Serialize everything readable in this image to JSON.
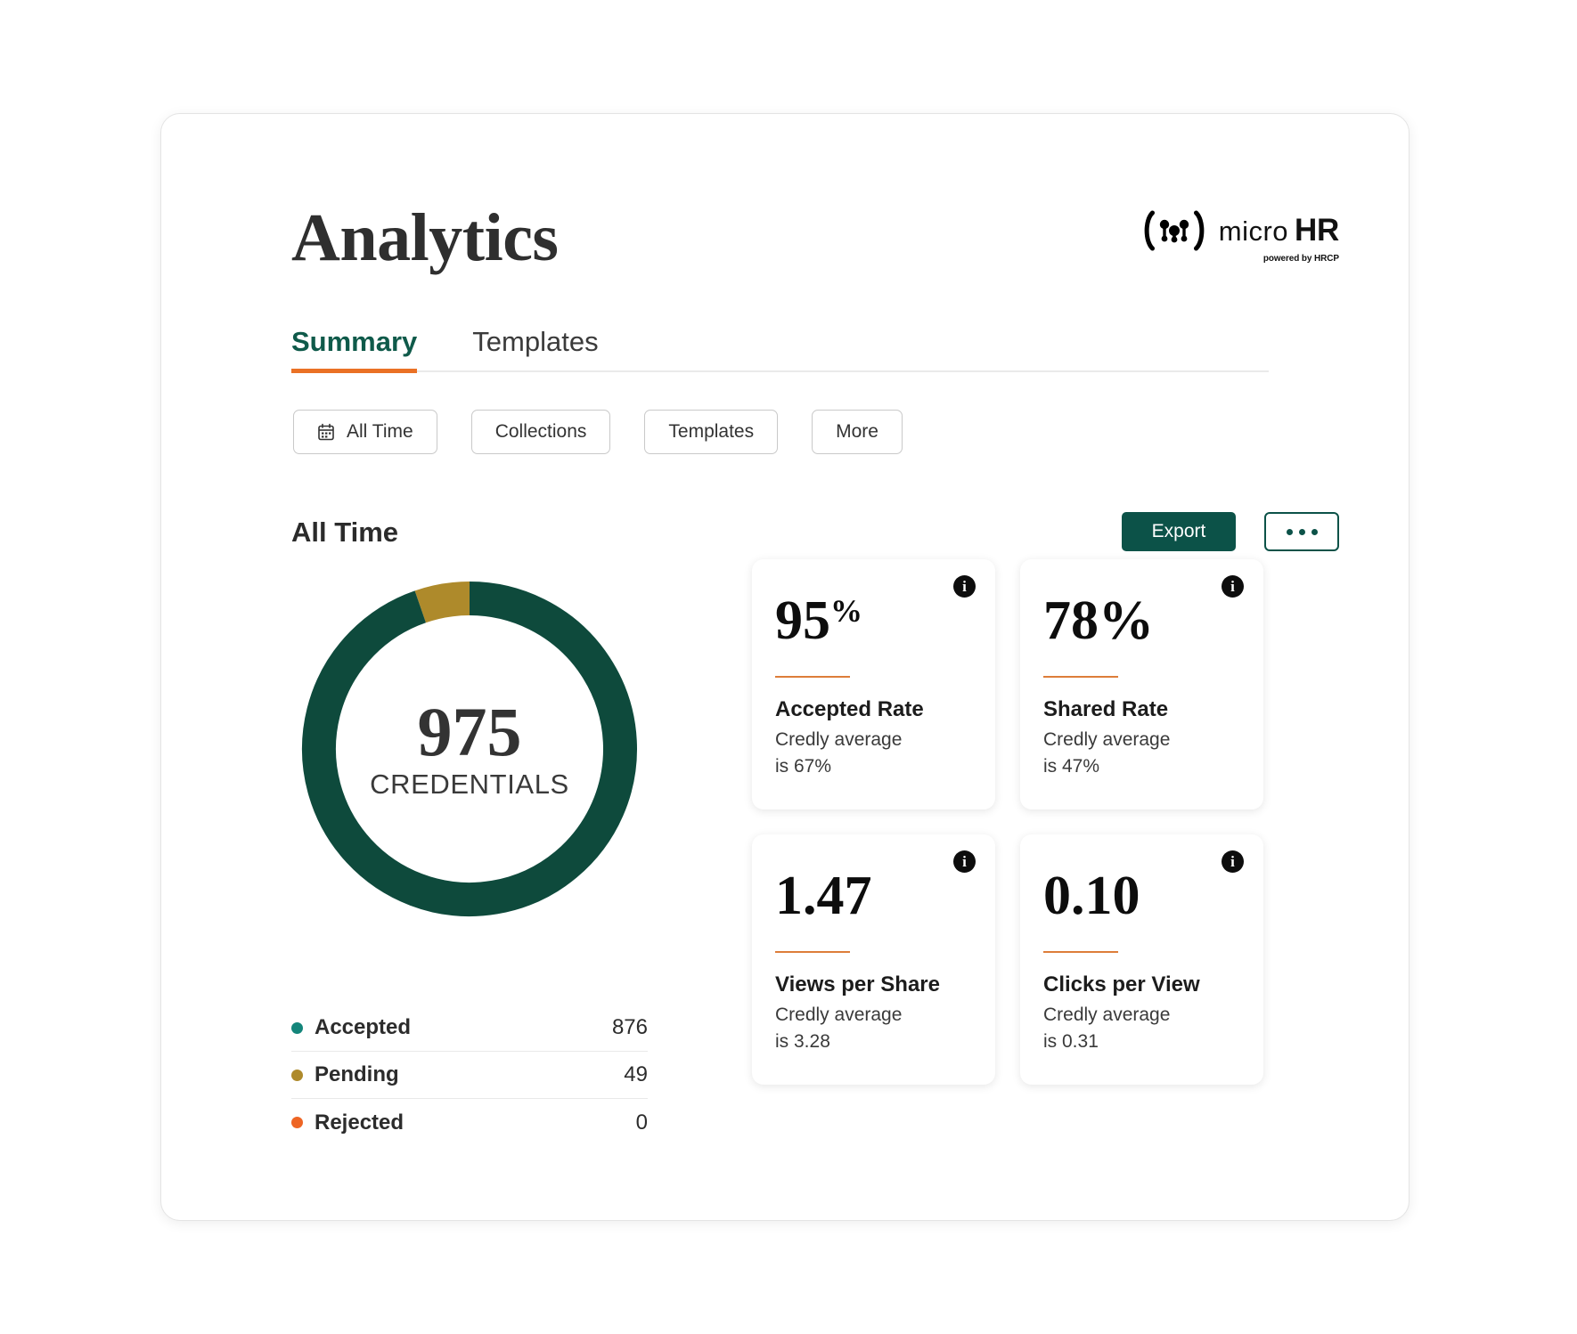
{
  "header": {
    "title": "Analytics",
    "brand": {
      "mark_name": "micro-hr-logo-icon",
      "micro": "micro",
      "hr": "HR",
      "powered": "powered by HRCP"
    }
  },
  "tabs": [
    {
      "label": "Summary",
      "active": true
    },
    {
      "label": "Templates",
      "active": false
    }
  ],
  "filters": [
    {
      "label": "All Time",
      "icon": "calendar-icon"
    },
    {
      "label": "Collections",
      "icon": ""
    },
    {
      "label": "Templates",
      "icon": ""
    },
    {
      "label": "More",
      "icon": ""
    }
  ],
  "section": {
    "title": "All Time",
    "export_label": "Export",
    "more_label": "..."
  },
  "chart_data": {
    "type": "pie",
    "title": "975 CREDENTIALS",
    "center_value": "975",
    "center_label": "CREDENTIALS",
    "categories": [
      "Accepted",
      "Pending",
      "Rejected"
    ],
    "values": [
      876,
      49,
      0
    ],
    "display_values": [
      "876",
      "49",
      "0"
    ],
    "colors": [
      "#0e4a3c",
      "#ae8a2b",
      "#ee6524"
    ],
    "legend_dot_colors": [
      "#13857a",
      "#ae8a2b",
      "#ee6524"
    ],
    "total": 975,
    "donut": true,
    "inner_radius_ratio": 0.78,
    "legend": "bottom-left",
    "grid": false
  },
  "stat_cards": [
    {
      "value": "95",
      "suffix": "%",
      "suffix_style": "superscript",
      "title": "Accepted Rate",
      "subtitle_line1": "Credly average",
      "subtitle_line2": "is 67%",
      "info_icon": "info-icon"
    },
    {
      "value": "78%",
      "suffix": "",
      "suffix_style": "inline",
      "title": "Shared Rate",
      "subtitle_line1": "Credly average",
      "subtitle_line2": "is 47%",
      "info_icon": "info-icon"
    },
    {
      "value": "1.47",
      "suffix": "",
      "suffix_style": "inline",
      "title": "Views per Share",
      "subtitle_line1": "Credly average",
      "subtitle_line2": "is 3.28",
      "info_icon": "info-icon"
    },
    {
      "value": "0.10",
      "suffix": "",
      "suffix_style": "inline",
      "title": "Clicks per View",
      "subtitle_line1": "Credly average",
      "subtitle_line2": "is 0.31",
      "info_icon": "info-icon"
    }
  ],
  "colors": {
    "brand_green": "#0c5248",
    "tab_active": "#0f5a4a",
    "tab_underline": "#ea7125",
    "accent_orange": "#dd7d3a",
    "donut_green": "#0e4a3c",
    "donut_gold": "#ae8a2b",
    "rejected_orange": "#ee6524"
  }
}
